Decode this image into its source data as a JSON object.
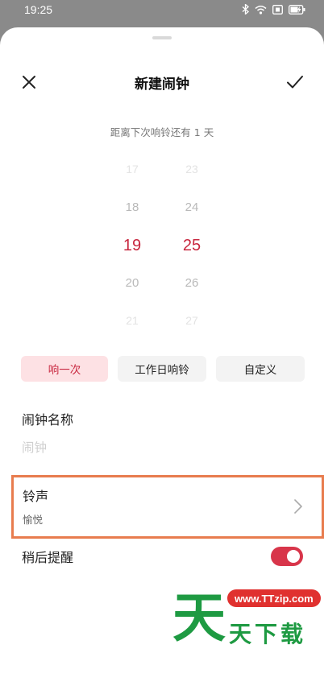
{
  "status_bar": {
    "time": "19:25",
    "icons": [
      "bluetooth-icon",
      "wifi-icon",
      "sim-icon",
      "battery-charging-icon"
    ]
  },
  "header": {
    "title": "新建闹钟",
    "close_icon": "close-icon",
    "confirm_icon": "check-icon"
  },
  "countdown_text": "距离下次响铃还有 1 天",
  "time_picker": {
    "hours": [
      "17",
      "18",
      "19",
      "20",
      "21"
    ],
    "minutes": [
      "23",
      "24",
      "25",
      "26",
      "27"
    ],
    "selected_hour": "19",
    "selected_minute": "25"
  },
  "repeat_options": {
    "once": "响一次",
    "workday": "工作日响铃",
    "custom": "自定义",
    "selected": "响一次"
  },
  "alarm_name": {
    "label": "闹钟名称",
    "placeholder": "闹钟",
    "value": ""
  },
  "ringtone": {
    "label": "铃声",
    "value": "愉悦"
  },
  "snooze": {
    "label": "稍后提醒",
    "enabled": true
  },
  "watermark": {
    "mark": "天",
    "url": "www.TTzip.com",
    "text": "天下载"
  },
  "colors": {
    "accent": "#c8273f",
    "chip_active_bg": "#fde1e4",
    "toggle_on": "#d8354a",
    "highlight_border": "#e87c4e",
    "watermark_green": "#1e9a42",
    "watermark_red": "#e0312f"
  }
}
